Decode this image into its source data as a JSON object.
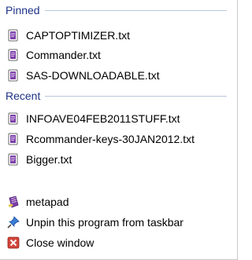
{
  "pinned": {
    "header": "Pinned",
    "items": [
      {
        "label": "CAPTOPTIMIZER.txt",
        "icon": "metapad-file-icon"
      },
      {
        "label": "Commander.txt",
        "icon": "metapad-file-icon"
      },
      {
        "label": "SAS-DOWNLOADABLE.txt",
        "icon": "metapad-file-icon"
      }
    ]
  },
  "recent": {
    "header": "Recent",
    "items": [
      {
        "label": "INFOAVE04FEB2011STUFF.txt",
        "icon": "metapad-file-icon"
      },
      {
        "label": "Rcommander-keys-30JAN2012.txt",
        "icon": "metapad-file-icon"
      },
      {
        "label": "Bigger.txt",
        "icon": "metapad-file-icon"
      }
    ]
  },
  "tasks": [
    {
      "label": "metapad",
      "icon": "metapad-app-icon"
    },
    {
      "label": "Unpin this program from taskbar",
      "icon": "unpin-icon"
    },
    {
      "label": "Close window",
      "icon": "close-window-icon"
    }
  ],
  "colors": {
    "header_text": "#1e3287",
    "divider": "#b9c7da",
    "file_icon": "#7c3fa8",
    "close_icon": "#c0392b"
  }
}
